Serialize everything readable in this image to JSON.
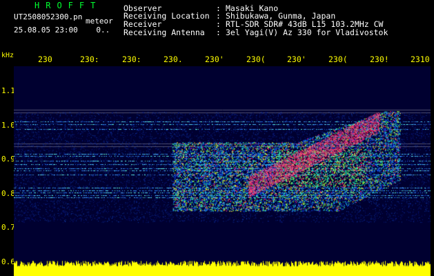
{
  "header": {
    "brand": "HROFFT",
    "filename": "UT2508052300.pn",
    "datetime": "25.08.05 23:00",
    "count": "0..",
    "meteor_label": "meteor"
  },
  "info": [
    {
      "label": "Observer",
      "value": "Masaki Kano"
    },
    {
      "label": "Receiving Location",
      "value": "Shibukawa, Gunma, Japan"
    },
    {
      "label": "Receiver",
      "value": "RTL-SDR SDR# 43dB L15 103.2MHz CW"
    },
    {
      "label": "Receiving Antenna",
      "value": "3el Yagi(V) Az 330 for Vladivostok"
    }
  ],
  "axes": {
    "y_unit": "kHz",
    "x_ticks": [
      "230",
      "230:",
      "230:",
      "230.",
      "230'",
      "230(",
      "230'",
      "230(",
      "230!",
      "2310"
    ],
    "y_ticks": [
      "1.1",
      "1.0",
      "0.9",
      "0.8",
      "0.7",
      "0.6"
    ]
  },
  "colors": {
    "background": "#000000",
    "plot_background": "#000030",
    "label": "#ffff00",
    "brand": "#00ff30",
    "noise": "#ffff00"
  }
}
